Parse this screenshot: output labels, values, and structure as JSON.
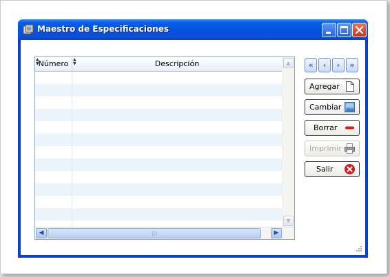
{
  "window": {
    "title": "Maestro de Especificaciones"
  },
  "grid": {
    "columns": [
      "Número",
      "Descripción"
    ],
    "rows": []
  },
  "nav": {
    "first": "«",
    "prev": "‹",
    "next": "›",
    "last": "»"
  },
  "actions": {
    "agregar": "Agregar",
    "cambiar": "Cambiar",
    "borrar": "Borrar",
    "imprimir": "Imprimir",
    "salir": "Salir"
  },
  "icons": {
    "app": "app-cube-icon",
    "agregar": "blank-page-icon",
    "cambiar": "image-icon",
    "borrar": "red-dash-icon",
    "imprimir": "printer-icon",
    "salir": "red-x-circle-icon"
  },
  "colors": {
    "title_bar": "#0454e0",
    "row_alt": "#ebf3fb",
    "accent_red": "#d81e1e"
  },
  "state": {
    "imprimir_enabled": false
  }
}
